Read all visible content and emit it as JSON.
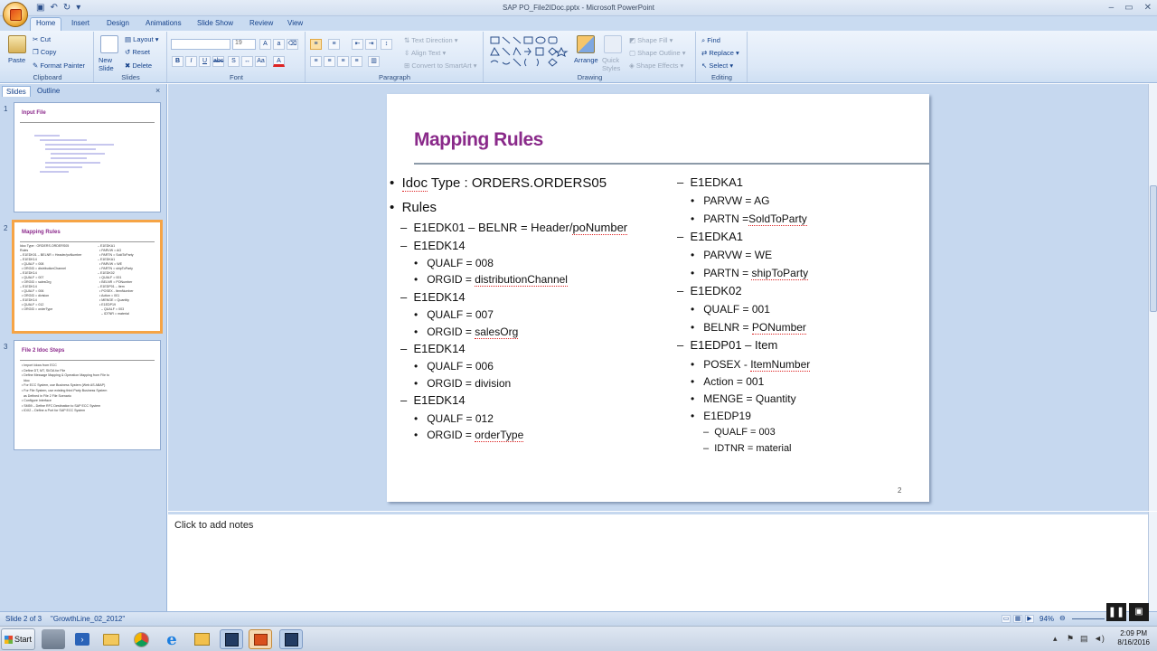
{
  "window": {
    "title": "SAP PO_File2IDoc.pptx - Microsoft PowerPoint"
  },
  "tabs": [
    "Home",
    "Insert",
    "Design",
    "Animations",
    "Slide Show",
    "Review",
    "View"
  ],
  "ribbon": {
    "clipboard": {
      "label": "Clipboard",
      "paste": "Paste",
      "cut": "Cut",
      "copy": "Copy",
      "format_painter": "Format Painter"
    },
    "slides": {
      "label": "Slides",
      "new_slide": "New Slide",
      "layout": "Layout",
      "reset": "Reset",
      "delete": "Delete"
    },
    "font": {
      "label": "Font",
      "size": "19"
    },
    "paragraph": {
      "label": "Paragraph",
      "text_direction": "Text Direction",
      "align_text": "Align Text",
      "convert_smartart": "Convert to SmartArt"
    },
    "drawing": {
      "label": "Drawing",
      "arrange": "Arrange",
      "quick_styles": "Quick Styles",
      "shape_fill": "Shape Fill",
      "shape_outline": "Shape Outline",
      "shape_effects": "Shape Effects"
    },
    "editing": {
      "label": "Editing",
      "find": "Find",
      "replace": "Replace",
      "select": "Select"
    }
  },
  "pane": {
    "tab_slides": "Slides",
    "tab_outline": "Outline",
    "close": "×"
  },
  "thumbnails": [
    {
      "num": "1",
      "title": "Input File"
    },
    {
      "num": "2",
      "title": "Mapping Rules"
    },
    {
      "num": "3",
      "title": "File 2 Idoc Steps"
    }
  ],
  "thumb3_lines": [
    "Import Idocs from ECC",
    "Define DT, MT, SI/OA for File",
    "Define Message Mapping & Operation Mapping from File to",
    "Idoc",
    "For ECC System, use Business System (Web AS ABAP)",
    "For File System, use existing third Party Business System",
    "as Defined in File 2 File Scenario",
    "Configure Interface",
    "SM59 – Define RFC Destination to SAP ECC System",
    "IDX2 – Define a Port for SAP ECC System"
  ],
  "slide": {
    "title": "Mapping Rules",
    "page_number": "2",
    "left": {
      "idoc_type_a": "Idoc",
      "idoc_type_b": " Type : ORDERS.ORDERS05",
      "rules": "Rules",
      "r1_a": "E1EDK01 – BELNR = Header/",
      "r1_b": "poNumber",
      "seg1": "E1EDK14",
      "s1_qualf": "QUALF = 008",
      "s1_orgid_a": "ORGID = ",
      "s1_orgid_b": "distributionChannel",
      "seg2": "E1EDK14",
      "s2_qualf": "QUALF = 007",
      "s2_orgid_a": "ORGID = ",
      "s2_orgid_b": "salesOrg",
      "seg3": "E1EDK14",
      "s3_qualf": "QUALF = 006",
      "s3_orgid": "ORGID = division",
      "seg4": "E1EDK14",
      "s4_qualf": "QUALF = 012",
      "s4_orgid_a": "ORGID = ",
      "s4_orgid_b": "orderType"
    },
    "right": {
      "k1": "E1EDKA1",
      "k1_parvw": "PARVW = AG",
      "k1_partn_a": "PARTN =",
      "k1_partn_b": "SoldToParty",
      "k2": "E1EDKA1",
      "k2_parvw": "PARVW = WE",
      "k2_partn_a": "PARTN = ",
      "k2_partn_b": "shipToParty",
      "k3": "E1EDK02",
      "k3_qualf": "QUALF = 001",
      "k3_belnr_a": "BELNR = ",
      "k3_belnr_b": "PONumber",
      "k4": "E1EDP01 – Item",
      "k4_posex_a": "POSEX  - ",
      "k4_posex_b": "ItemNumber",
      "k4_action": "Action = 001",
      "k4_menge": "MENGE = Quantity",
      "k5": "E1EDP19",
      "k5_qualf": "QUALF = 003",
      "k5_idtnr": "IDTNR = material"
    }
  },
  "notes": {
    "placeholder": "Click to add notes"
  },
  "status": {
    "slide": "Slide 2 of 3",
    "theme": "\"GrowthLine_02_2012\"",
    "zoom": "94%"
  },
  "taskbar": {
    "start": "Start",
    "time": "2:09 PM",
    "date": "8/16/2016"
  }
}
